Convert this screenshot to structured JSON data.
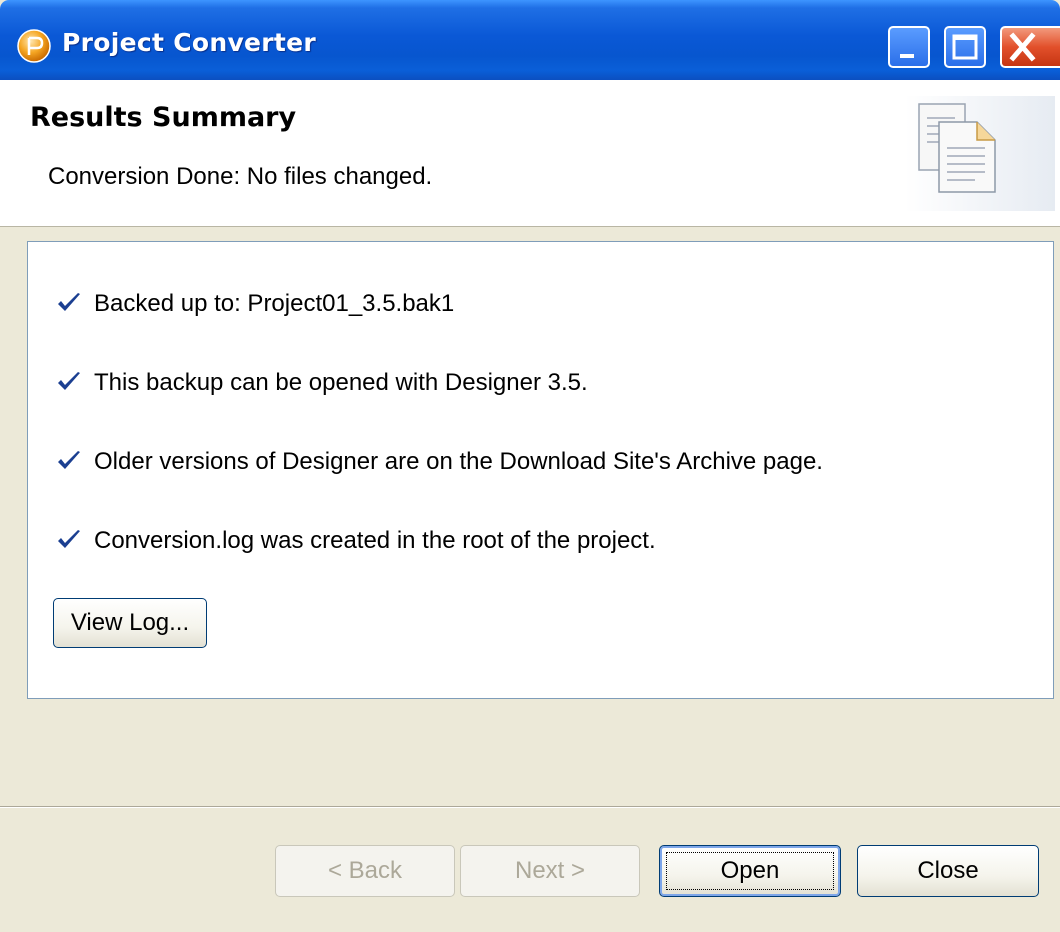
{
  "window": {
    "title": "Project Converter"
  },
  "header": {
    "title": "Results Summary",
    "description": "Conversion Done: No files changed."
  },
  "results": [
    {
      "label": "Backed up to:  Project01_3.5.bak1"
    },
    {
      "label": "This backup can be opened with Designer 3.5."
    },
    {
      "label": "Older versions of Designer are on the Download Site's Archive page."
    },
    {
      "label": "Conversion.log was created in the root of the project."
    }
  ],
  "buttons": {
    "view_log": "View Log...",
    "back": "< Back",
    "next": "Next >",
    "open": "Open",
    "close": "Close"
  },
  "colors": {
    "titlebar": "#0a58d6",
    "check": "#1b3f91",
    "panel_border": "#7f9db9",
    "dialog_bg": "#ece9d8"
  },
  "icons": {
    "app": "app-icon",
    "header": "documents-icon",
    "check": "check-icon"
  }
}
